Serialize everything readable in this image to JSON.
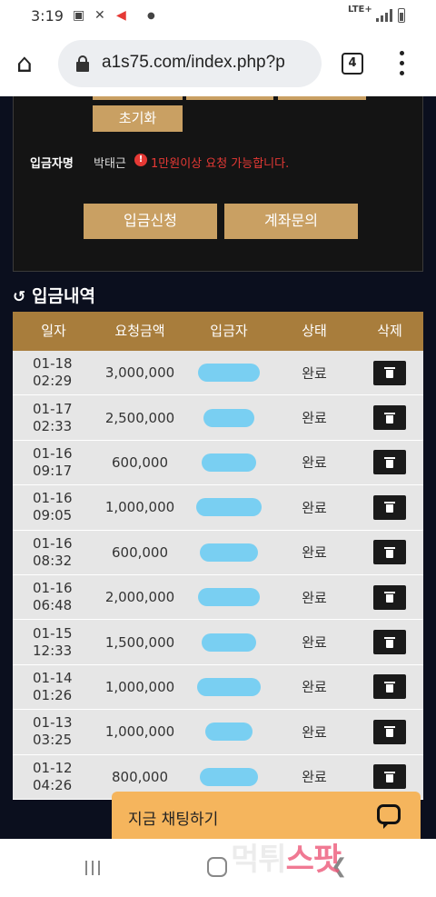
{
  "status_bar": {
    "time": "3:19",
    "network": "LTE+"
  },
  "browser": {
    "url": "a1s75.com/index.php?p",
    "tab_count": "4"
  },
  "deposit_form": {
    "reset_label": "초기화",
    "depositor_label": "입금자명",
    "depositor_name": "박태근",
    "warning_icon": "!",
    "warning_text": "1만원이상 요청 가능합니다.",
    "request_button": "입금신청",
    "account_inquiry_button": "계좌문의"
  },
  "history": {
    "title": "입금내역",
    "columns": [
      "일자",
      "요청금액",
      "입금자",
      "상태",
      "삭제"
    ],
    "rows": [
      {
        "date": "01-18",
        "time": "02:29",
        "amount": "3,000,000",
        "status": "완료"
      },
      {
        "date": "01-17",
        "time": "02:33",
        "amount": "2,500,000",
        "status": "완료"
      },
      {
        "date": "01-16",
        "time": "09:17",
        "amount": "600,000",
        "status": "완료"
      },
      {
        "date": "01-16",
        "time": "09:05",
        "amount": "1,000,000",
        "status": "완료"
      },
      {
        "date": "01-16",
        "time": "08:32",
        "amount": "600,000",
        "status": "완료"
      },
      {
        "date": "01-16",
        "time": "06:48",
        "amount": "2,000,000",
        "status": "완료"
      },
      {
        "date": "01-15",
        "time": "12:33",
        "amount": "1,500,000",
        "status": "완료"
      },
      {
        "date": "01-14",
        "time": "01:26",
        "amount": "1,000,000",
        "status": "완료"
      },
      {
        "date": "01-13",
        "time": "03:25",
        "amount": "1,000,000",
        "status": "완료"
      },
      {
        "date": "01-12",
        "time": "04:26",
        "amount": "800,000",
        "status": "완료"
      }
    ]
  },
  "chat": {
    "label": "지금 채팅하기"
  },
  "watermark": {
    "part1": "먹튀",
    "part2": "스팟"
  },
  "colors": {
    "gold": "#c9a063",
    "header_brown": "#a87d3c",
    "chat_orange": "#f5b55d",
    "warning_red": "#e53935",
    "redaction_blue": "#79cff2"
  }
}
